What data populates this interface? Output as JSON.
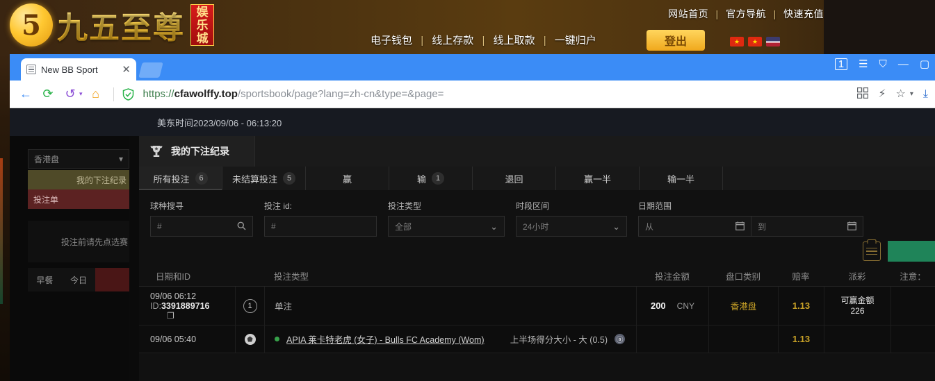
{
  "site": {
    "logo_mark": "5",
    "logo_text": "九五至尊",
    "logo_badge": "娱乐城",
    "top_nav": [
      "网站首页",
      "官方导航",
      "快速充值"
    ],
    "mid_nav": [
      "电子钱包",
      "线上存款",
      "线上取款",
      "一键归户"
    ],
    "logout_label": "登出",
    "flags": [
      "hk-flag-icon",
      "cn-flag-icon",
      "us-flag-icon"
    ]
  },
  "browser": {
    "tab": {
      "title": "New BB Sport",
      "favicon": "document-icon",
      "close": "✕"
    },
    "tab_count": "1",
    "window_controls": {
      "menu": "☰",
      "collections": "⛉",
      "minimize": "—",
      "maximize": "▢"
    },
    "nav": {
      "back": "←",
      "reload": "⟳",
      "history": "↺",
      "home": "⌂",
      "history_caret": "▾"
    },
    "url": {
      "scheme": "https://",
      "domain": "cfawolffy.top",
      "path": "/sportsbook/page?lang=zh-cn&type=&page="
    },
    "nav_right": {
      "qr": "qr-icon",
      "flash": "⚡",
      "star": "☆",
      "caret": "▾",
      "download": "⤓"
    }
  },
  "page": {
    "server_time": "美东时间2023/09/06 - 06:13:20",
    "sidebar": {
      "odds_format": "香港盘",
      "my_bets": "我的下注纪录",
      "bet_slip": "投注单",
      "hint": "投注前请先点选赛",
      "bottom_tabs": [
        "早餐",
        "今日",
        ""
      ]
    },
    "panel": {
      "title": "我的下注纪录",
      "title_icon": "trophy-icon",
      "tabs": [
        {
          "label": "所有投注",
          "count": "6",
          "active": true
        },
        {
          "label": "未结算投注",
          "count": "5",
          "active": false
        },
        {
          "label": "赢",
          "count": "",
          "active": false
        },
        {
          "label": "输",
          "count": "1",
          "active": false
        },
        {
          "label": "退回",
          "count": "",
          "active": false
        },
        {
          "label": "赢一半",
          "count": "",
          "active": false
        },
        {
          "label": "输一半",
          "count": "",
          "active": false
        }
      ],
      "filters": {
        "sport_search": {
          "label": "球种搜寻",
          "placeholder": "#",
          "value": "",
          "icon": "search-icon"
        },
        "bet_id": {
          "label": "投注 id:",
          "placeholder": "#",
          "value": ""
        },
        "bet_type": {
          "label": "投注类型",
          "value": "全部",
          "caret": "⌄"
        },
        "period": {
          "label": "时段区间",
          "value": "24小时",
          "caret": "⌄"
        },
        "date_range": {
          "label": "日期范围",
          "from_placeholder": "从",
          "to_placeholder": "到",
          "icon": "calendar-icon"
        }
      },
      "actions": {
        "clipboard": "clipboard-icon",
        "submit": ""
      },
      "table": {
        "columns": [
          "日期和ID",
          "",
          "投注类型",
          "投注金额",
          "盘口类别",
          "赔率",
          "派彩",
          "注意："
        ],
        "rows": [
          {
            "date": "09/06 06:12",
            "id_label": "ID:",
            "id": "3391889716",
            "copy_icon": "copy-icon",
            "leg_number": "1",
            "bet_type": "单注",
            "amount": "200",
            "currency": "CNY",
            "market": "香港盘",
            "odds": "1.13",
            "payout_label": "可赢金额",
            "payout_value": "226",
            "note": ""
          },
          {
            "date": "09/06 05:40",
            "sport_icon": "soccer-icon",
            "live_dot": "live-indicator",
            "match": "APIA 莱卡特老虎 (女子) - Bulls FC Academy (Wom)",
            "selection": "上半场得分大小 - 大 (0.5)",
            "info_icon": "info-icon",
            "amount": "",
            "currency": "",
            "market": "",
            "odds": "1.13",
            "payout_label": "",
            "payout_value": "",
            "note": ""
          }
        ]
      }
    }
  }
}
